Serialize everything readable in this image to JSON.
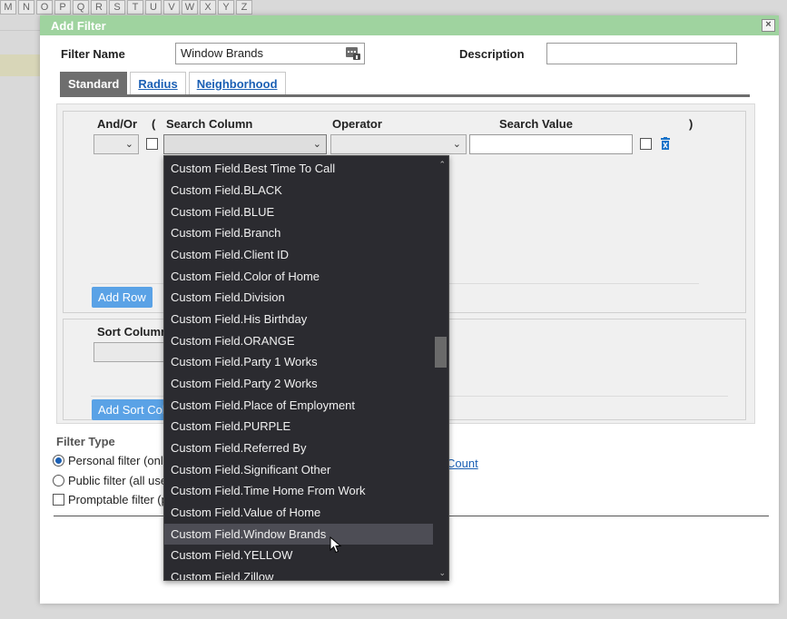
{
  "background": {
    "letters": [
      "M",
      "N",
      "O",
      "P",
      "Q",
      "R",
      "S",
      "T",
      "U",
      "V",
      "W",
      "X",
      "Y",
      "Z"
    ]
  },
  "dialog": {
    "title": "Add Filter",
    "close_icon": "×"
  },
  "form": {
    "filter_name_label": "Filter Name",
    "filter_name_value": "Window Brands",
    "description_label": "Description",
    "description_value": ""
  },
  "tabs": [
    {
      "label": "Standard",
      "active": true
    },
    {
      "label": "Radius",
      "active": false
    },
    {
      "label": "Neighborhood",
      "active": false
    }
  ],
  "criteria": {
    "headers": {
      "and_or": "And/Or",
      "open_paren": "(",
      "search_column": "Search Column",
      "operator": "Operator",
      "search_value": "Search Value",
      "close_paren": ")"
    },
    "add_row_label": "Add Row"
  },
  "sort": {
    "header": "Sort Column",
    "add_sort_label": "Add Sort Col"
  },
  "filter_type": {
    "label": "Filter Type",
    "options": [
      {
        "label": "Personal filter (onl",
        "selected": true
      },
      {
        "label": "Public filter (all use",
        "selected": false
      }
    ],
    "promptable_label": "Promptable filter (p",
    "count_link": "Count"
  },
  "dropdown": {
    "items": [
      "Custom Field.Best Time To Call",
      "Custom Field.BLACK",
      "Custom Field.BLUE",
      "Custom Field.Branch",
      "Custom Field.Client ID",
      "Custom Field.Color of Home",
      "Custom Field.Division",
      "Custom Field.His Birthday",
      "Custom Field.ORANGE",
      "Custom Field.Party 1 Works",
      "Custom Field.Party 2 Works",
      "Custom Field.Place of Employment",
      "Custom Field.PURPLE",
      "Custom Field.Referred By",
      "Custom Field.Significant Other",
      "Custom Field.Time Home From Work",
      "Custom Field.Value of Home",
      "Custom Field.Window Brands",
      "Custom Field.YELLOW",
      "Custom Field.Zillow"
    ],
    "highlighted": "Custom Field.Window Brands"
  },
  "colors": {
    "titlebar": "#9fd39f",
    "accent_button": "#5aa2e6",
    "link": "#1a5fb4",
    "dropdown_bg": "#2b2b30"
  }
}
